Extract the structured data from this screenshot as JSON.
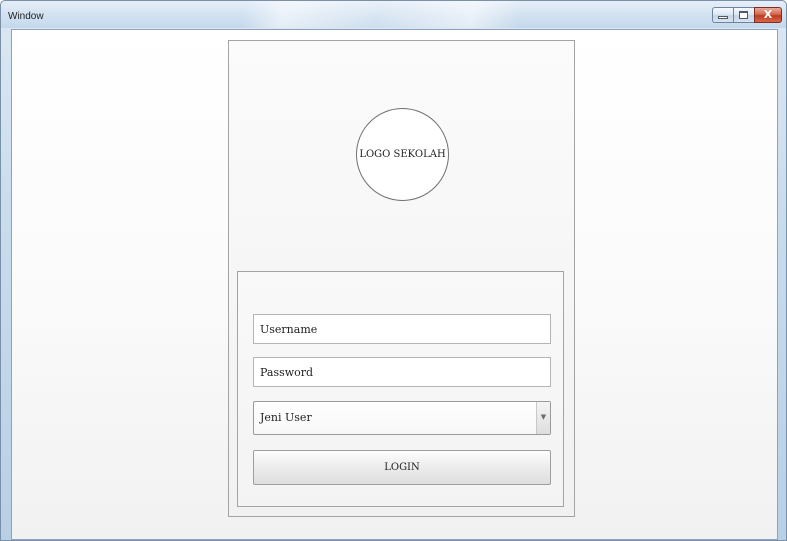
{
  "window": {
    "title": "Window",
    "close_glyph": "X"
  },
  "logo": {
    "text": "LOGO SEKOLAH"
  },
  "form": {
    "username_placeholder": "Username",
    "password_placeholder": "Password",
    "user_type_selected": "Jeni User",
    "dropdown_arrow": "▼",
    "login_label": "LOGIN"
  },
  "icons": {
    "minimize": "minimize-icon",
    "maximize": "maximize-icon",
    "close": "close-icon",
    "dropdown": "chevron-down-icon"
  },
  "colors": {
    "close_button": "#c9452a",
    "titlebar": "#d3e2f1",
    "panel_border": "#a3a3a3"
  }
}
